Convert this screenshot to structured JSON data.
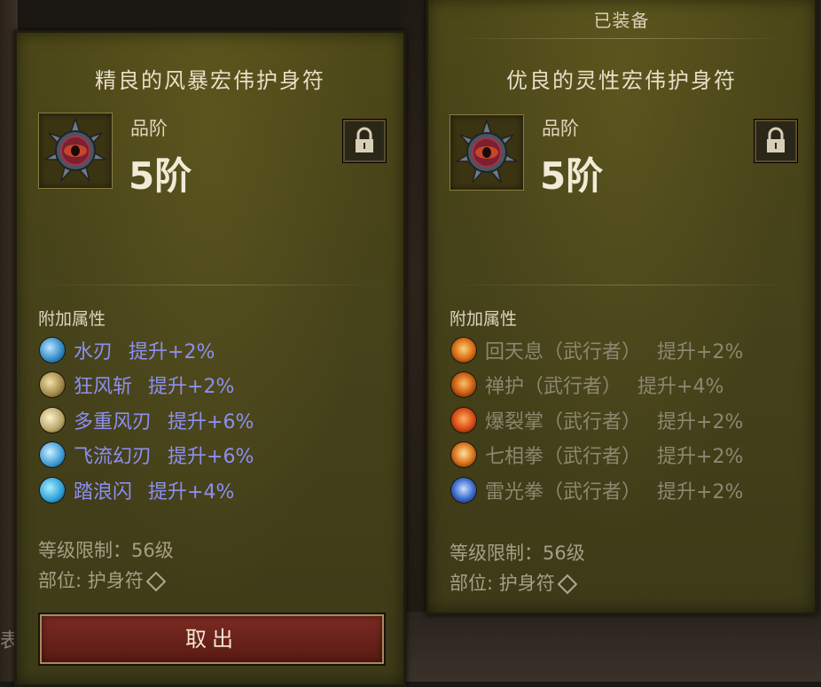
{
  "background": {
    "side_char": "表"
  },
  "left_item": {
    "title": "精良的风暴宏伟护身符",
    "grade_label": "品阶",
    "grade_value": "5阶",
    "attributes_header": "附加属性",
    "attributes": [
      {
        "name": "水刃",
        "bonus": "提升+2%",
        "icon": "water-blade-icon",
        "color": "#4aa0d8"
      },
      {
        "name": "狂风斩",
        "bonus": "提升+2%",
        "icon": "gale-slash-icon",
        "color": "#c9b27a"
      },
      {
        "name": "多重风刃",
        "bonus": "提升+6%",
        "icon": "multi-wind-blade-icon",
        "color": "#d8c98e"
      },
      {
        "name": "飞流幻刃",
        "bonus": "提升+6%",
        "icon": "flying-phantom-blade-icon",
        "color": "#58b6e0"
      },
      {
        "name": "踏浪闪",
        "bonus": "提升+4%",
        "icon": "wave-step-flash-icon",
        "color": "#4ab3e6"
      }
    ],
    "level_req": "等级限制：56级",
    "slot": "部位: 护身符",
    "action_label": "取出"
  },
  "right_item": {
    "equipped_label": "已装备",
    "title": "优良的灵性宏伟护身符",
    "grade_label": "品阶",
    "grade_value": "5阶",
    "attributes_header": "附加属性",
    "attributes": [
      {
        "name": "回天息（武行者）",
        "bonus": "提升+2%",
        "icon": "heavenly-breath-icon",
        "color": "#e07a1e"
      },
      {
        "name": "禅护（武行者）",
        "bonus": "提升+4%",
        "icon": "zen-guard-icon",
        "color": "#d86a18"
      },
      {
        "name": "爆裂掌（武行者）",
        "bonus": "提升+2%",
        "icon": "burst-palm-icon",
        "color": "#e05a1a"
      },
      {
        "name": "七相拳（武行者）",
        "bonus": "提升+2%",
        "icon": "seven-aspect-fist-icon",
        "color": "#e0781c"
      },
      {
        "name": "雷光拳（武行者）",
        "bonus": "提升+2%",
        "icon": "thunder-fist-icon",
        "color": "#3f7ad8"
      }
    ],
    "level_req": "等级限制：56级",
    "slot": "部位: 护身符"
  },
  "colors": {
    "panel_bg": "#46421a",
    "active_attr": "#8d8ff0",
    "inactive_attr": "#8c8770",
    "button_bg": "#6a2219"
  }
}
